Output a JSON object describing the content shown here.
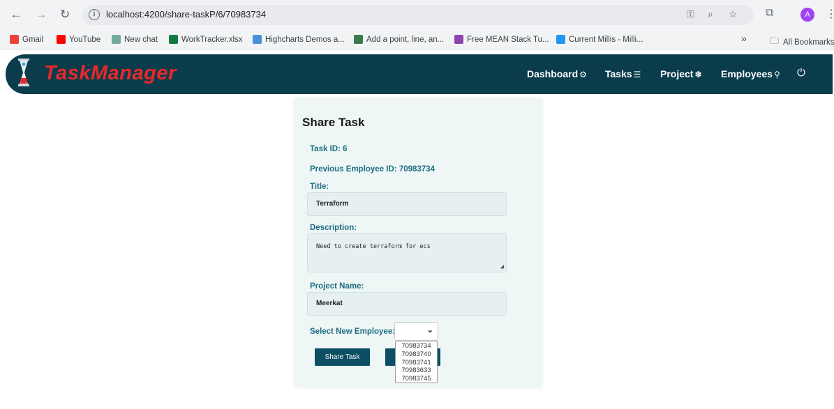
{
  "browser": {
    "url": "localhost:4200/share-taskP/6/70983734",
    "bookmarks": [
      {
        "label": "Gmail",
        "color": "#ea4335"
      },
      {
        "label": "YouTube",
        "color": "#ff0000"
      },
      {
        "label": "New chat",
        "color": "#74aa9c"
      },
      {
        "label": "WorkTracker.xlsx",
        "color": "#107c41"
      },
      {
        "label": "Highcharts Demos a...",
        "color": "#4a90d9"
      },
      {
        "label": "Add a point, line, an...",
        "color": "#3c7a4c"
      },
      {
        "label": "Free MEAN Stack Tu...",
        "color": "#8e44ad"
      },
      {
        "label": "Current Millis - Milli...",
        "color": "#2196f3"
      }
    ],
    "overflow_label": "»",
    "all_bookmarks_label": "All Bookmarks",
    "profile_initial": "A"
  },
  "app": {
    "brand": "TaskManager",
    "nav": [
      {
        "label": "Dashboard",
        "icon": "⚙"
      },
      {
        "label": "Tasks",
        "icon": "☰"
      },
      {
        "label": "Project",
        "icon": "✽"
      },
      {
        "label": "Employees",
        "icon": "⚲"
      }
    ],
    "power_icon": "⏻"
  },
  "form": {
    "title": "Share Task",
    "task_id": "Task ID: 6",
    "previous_employee": "Previous Employee ID: 70983734",
    "title_label": "Title:",
    "title_value": "Terraform",
    "description_label": "Description:",
    "description_value": "Need to create terraform for ecs",
    "project_label": "Project Name:",
    "project_value": "Meerkat",
    "select_label": "Select New Employee:",
    "employee_options": [
      "70983734",
      "70983740",
      "70983741",
      "70983633",
      "70983745"
    ],
    "share_button": "Share Task"
  }
}
